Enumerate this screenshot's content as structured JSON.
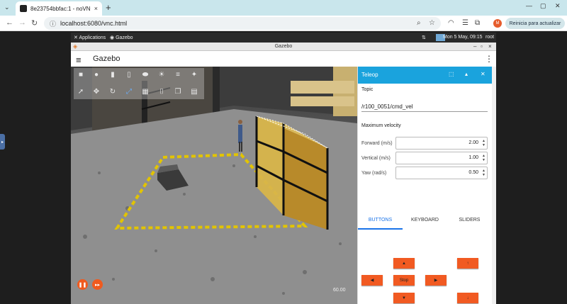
{
  "browser": {
    "tab_title": "8e23754bbfac:1 - noVNC",
    "tab_close": "×",
    "new_tab": "+",
    "url": "localhost:6080/vnc.html",
    "update_label": "Reinicia para actualizar",
    "avatar_initials": "M"
  },
  "desktop_panel": {
    "applications": "Applications",
    "gazebo_task": "Gazebo",
    "clock": "Mon  5 May, 09:15",
    "user": "root"
  },
  "gazebo": {
    "window_title": "Gazebo",
    "app_title": "Gazebo",
    "fps": "60.00"
  },
  "teleop": {
    "title": "Teleop",
    "topic_label": "Topic",
    "topic_value": "/r100_0051/cmd_vel",
    "max_velocity_label": "Maximum velocity",
    "rows": [
      {
        "label": "Forward (m/s)",
        "value": "2.00"
      },
      {
        "label": "Vertical (m/s)",
        "value": "1.00"
      },
      {
        "label": "Yaw (rad/s)",
        "value": "0.50"
      }
    ],
    "tabs": [
      "BUTTONS",
      "KEYBOARD",
      "SLIDERS"
    ],
    "active_tab": "BUTTONS",
    "buttons": {
      "up": "▲",
      "down": "▼",
      "left": "◀",
      "right": "▶",
      "stop": "Stop",
      "ascend": "↑",
      "descend": "↓"
    }
  },
  "colors": {
    "accent": "#1aa3dd",
    "button": "#f15a22",
    "tabbar": "#c9e6ec"
  }
}
